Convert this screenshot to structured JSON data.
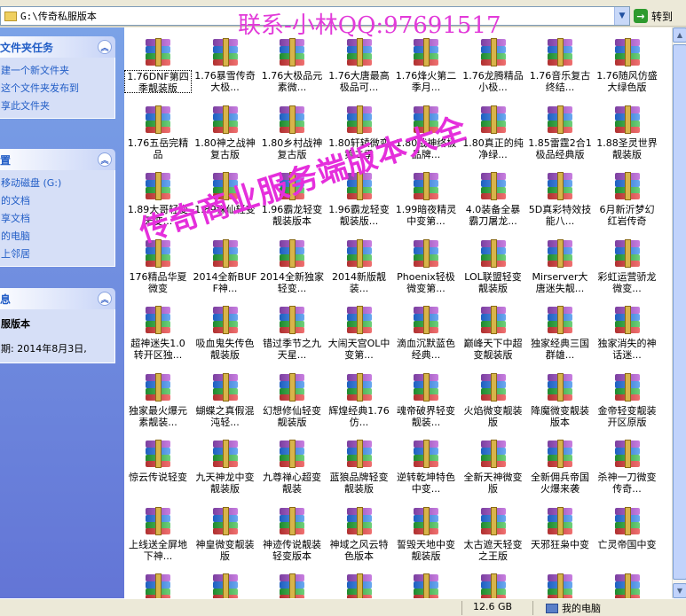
{
  "address": {
    "path": "G:\\传奇私服版本",
    "go_label": "转到"
  },
  "taskpane": {
    "file_tasks": {
      "title": "文件夹任务",
      "items": [
        "建一个新文件夹",
        "这个文件夹发布到",
        "享此文件夹"
      ]
    },
    "other_places": {
      "title": "置",
      "items": [
        "移动磁盘 (G:)",
        "的文档",
        "享文档",
        "的电脑",
        "上邻居"
      ]
    },
    "details": {
      "title": "息",
      "name": "服版本",
      "date": "期: 2014年8月3日,",
      "collapse_symbol": "⌃"
    }
  },
  "files": [
    "1.76DNF第四季靓装版",
    "1.76暴雪传奇大极...",
    "1.76大极品元素微...",
    "1.76大唐最高极品可...",
    "1.76烽火第二季月...",
    "1.76龙腾精品小极...",
    "1.76音乐复古终结...",
    "1.76随风仿盛大绿色版",
    "1.76五岳完精品",
    "1.80神之战神复古版",
    "1.80乡村战神复古版",
    "1.80轩辕微变第二季",
    "1.80战神终极品牌...",
    "1.80真正的纯净绿...",
    "1.85雷霆2合1极品经典版",
    "1.88圣灵世界靓装版",
    "1.89大哥轻变无变...",
    "1.89诛仙轻变",
    "1.96霸龙轻变靓装版本",
    "1.96霸龙轻变靓装版...",
    "1.99暗夜精灵中变第...",
    "4.0装备全暴霸刀屠龙...",
    "5D真彩特效技能八...",
    "6月新沂梦幻红岩传奇",
    "176精品华夏微变",
    "2014全新BUFF神...",
    "2014全新独家轻变...",
    "2014新版靓装...",
    "Phoenix轻极微变第...",
    "LOL联盟轻变靓装版",
    "Mirserver大唐迷失靓...",
    "彩虹运营骄龙微变...",
    "超神迷失1.0转开区独...",
    "吸血鬼失传色靓装版",
    "错过季节之九天星...",
    "大闹天宫OL中变第...",
    "滴血沉默蓝色经典...",
    "巅峰天下中超变靓装版",
    "独家经典三国群雄...",
    "独家消失的神话迷...",
    "独家最火爆元素靓装...",
    "蝴蝶之真假混沌轻...",
    "幻想修仙轻变靓装版",
    "辉煌经典1.76仿...",
    "魂帝破界轻变靓装...",
    "火焰微变靓装版",
    "降魔微变靓装版本",
    "金帝轻变靓装开区原版",
    "惊云传说轻变",
    "九天神龙中变靓装版",
    "九尊禅心超变靓装",
    "蓝狼品牌轻变靓装版",
    "逆转乾坤特色中变...",
    "全新天神微变版",
    "全新佣兵帝国火爆来袭",
    "杀神一刀微变传奇...",
    "上线送全屏地下神...",
    "神皇微变靓装版",
    "神迹传说靓装轻变版本",
    "神域之风云特色版本",
    "誓毁天地中变靓装版",
    "太古遮天轻变之王版",
    "天邪狂枭中变",
    "亡灵帝国中变",
    "",
    "",
    "",
    "",
    "",
    "",
    "",
    ""
  ],
  "selected_file_index": 0,
  "statusbar": {
    "size": "12.6 GB",
    "location": "我的电脑"
  },
  "watermarks": {
    "top": "联系-小林QQ:97691517",
    "diagonal": "传奇商业服务端版本大全"
  },
  "icons": {
    "file": "winrar-archive-icon",
    "go": "green-arrow-icon",
    "location": "my-computer-icon"
  }
}
